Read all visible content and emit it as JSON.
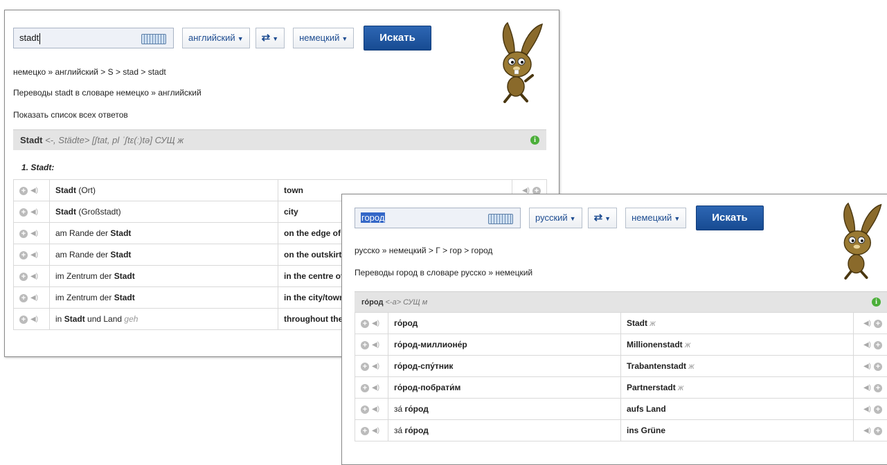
{
  "window1": {
    "search_value": "stadt",
    "source_lang": "английский",
    "swap_label": "⇄",
    "target_lang": "немецкий",
    "search_button": "Искать",
    "breadcrumb": "немецко » английский > S > stad > stadt",
    "translations_heading": "Переводы stadt в словаре немецко » английский",
    "show_all_link": "Показать список всех ответов",
    "entry": {
      "headword": "Stadt",
      "grammar": "<-, Städte> [ʃtat, pl ˈʃtɛ(ː)tə] СУЩ ж"
    },
    "sense_label": "1. Stadt:",
    "rows": [
      {
        "src_bold": "Stadt",
        "src_rest": " (Ort)",
        "tgt": "town"
      },
      {
        "src_bold": "Stadt",
        "src_rest": " (Großstadt)",
        "tgt": "city"
      },
      {
        "src_pre": "am Rande der ",
        "src_bold": "Stadt",
        "tgt": "on the edge of town"
      },
      {
        "src_pre": "am Rande der ",
        "src_bold": "Stadt",
        "tgt": "on the outskirts"
      },
      {
        "src_pre": "im Zentrum der ",
        "src_bold": "Stadt",
        "tgt": "in the centre of town"
      },
      {
        "src_pre": "im Zentrum der ",
        "src_bold": "Stadt",
        "tgt": "in the city/town centre"
      },
      {
        "src_pre": "in ",
        "src_bold": "Stadt",
        "src_rest": " und Land",
        "src_gen": "geh",
        "tgt": "throughout the land"
      }
    ]
  },
  "window2": {
    "search_value": "город",
    "source_lang": "русский",
    "swap_label": "⇄",
    "target_lang": "немецкий",
    "search_button": "Искать",
    "breadcrumb": "русско » немецкий > Г > гор > город",
    "translations_heading": "Переводы город в словаре русско » немецкий",
    "entry": {
      "headword": "го́род",
      "grammar": "<-а> СУЩ м"
    },
    "rows": [
      {
        "src": "го́род",
        "tgt": "Stadt",
        "gen": "ж"
      },
      {
        "src": "го́род-миллионе́р",
        "tgt": "Millionenstadt",
        "gen": "ж"
      },
      {
        "src": "го́род-спу́тник",
        "tgt": "Trabantenstadt",
        "gen": "ж"
      },
      {
        "src": "го́род-побрати́м",
        "tgt": "Partnerstadt",
        "gen": "ж"
      },
      {
        "src_pre": "за́ ",
        "src": "го́род",
        "tgt": "aufs Land",
        "gen": ""
      },
      {
        "src_pre": "за́ ",
        "src": "го́род",
        "tgt": "ins Grüne",
        "gen": ""
      }
    ]
  },
  "icons": [
    "keyboard-icon",
    "swap-arrows-icon",
    "plus-icon",
    "speaker-icon",
    "info-icon",
    "bunny-mascot"
  ],
  "colors": {
    "accent_blue": "#1d4c91",
    "button_blue": "#1f559f",
    "header_gray": "#e4e4e4",
    "info_green": "#4caf3a"
  }
}
